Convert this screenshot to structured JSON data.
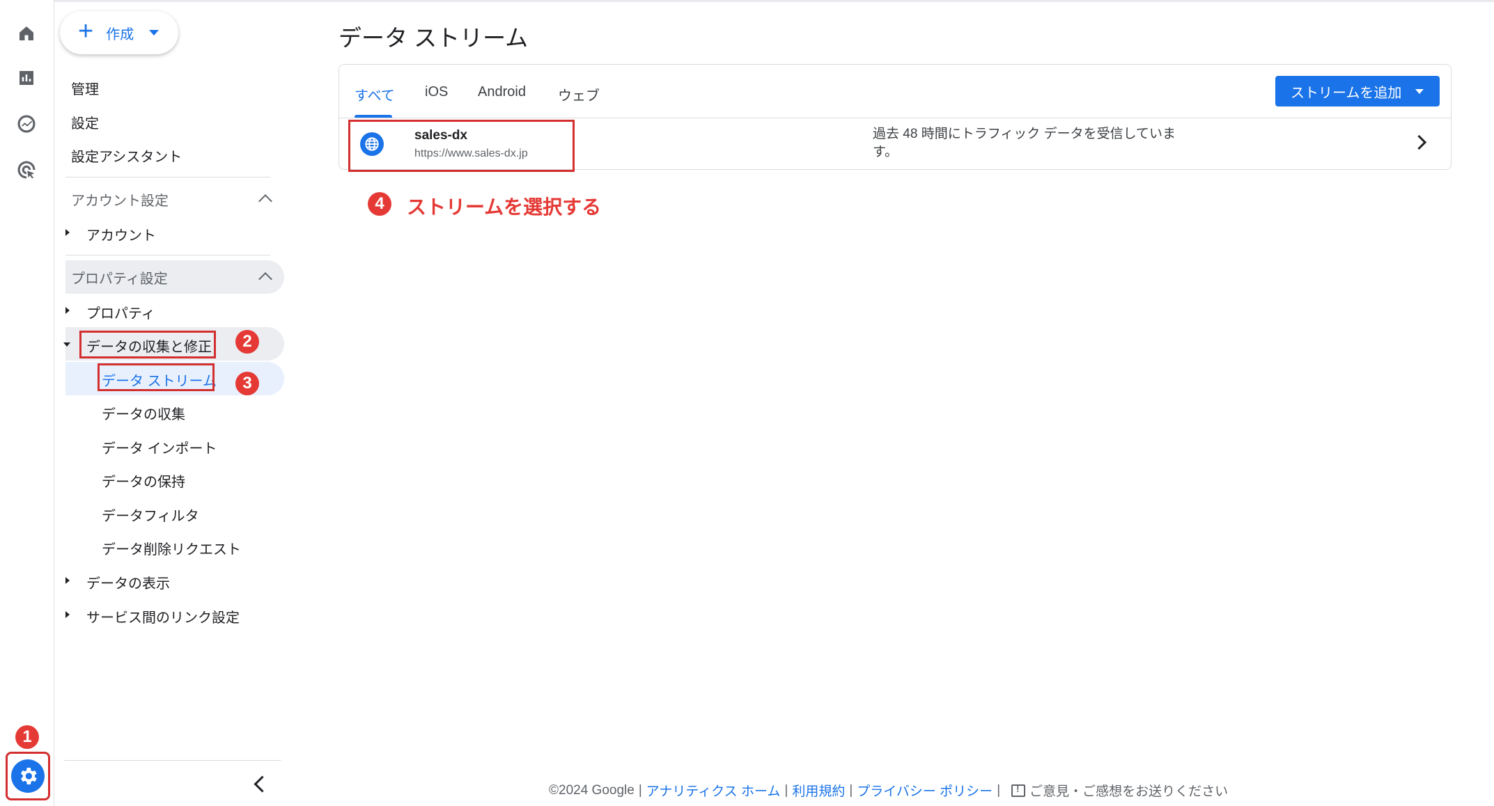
{
  "colors": {
    "accent": "#1a73e8",
    "annotation_red": "#e53935"
  },
  "rail": {
    "icons": [
      "home-icon",
      "reports-icon",
      "explore-icon",
      "advertising-icon"
    ],
    "settings_icon": "gear-icon"
  },
  "nav": {
    "create_label": "作成",
    "top_items": [
      "管理",
      "設定",
      "設定アシスタント"
    ],
    "account_section": {
      "title": "アカウント設定",
      "items": [
        "アカウント"
      ]
    },
    "property_section": {
      "title": "プロパティ設定",
      "items": [
        "プロパティ",
        "データの収集と修正",
        "データの表示",
        "サービス間のリンク設定"
      ],
      "sub_items": [
        "データ ストリーム",
        "データの収集",
        "データ インポート",
        "データの保持",
        "データフィルタ",
        "データ削除リクエスト"
      ]
    }
  },
  "badges": [
    "1",
    "2",
    "3",
    "4"
  ],
  "main": {
    "title": "データ ストリーム",
    "tabs": [
      "すべて",
      "iOS",
      "Android",
      "ウェブ"
    ],
    "add_stream_label": "ストリームを追加",
    "stream": {
      "name": "sales-dx",
      "url": "https://www.sales-dx.jp",
      "status": "過去 48 時間にトラフィック データを受信していま す。"
    },
    "annotation": "ストリームを選択する"
  },
  "footer": {
    "copyright": "©2024 Google",
    "links": [
      "アナリティクス ホーム",
      "利用規約",
      "プライバシー ポリシー"
    ],
    "feedback": "ご意見・ご感想をお送りください",
    "separator": "|"
  }
}
